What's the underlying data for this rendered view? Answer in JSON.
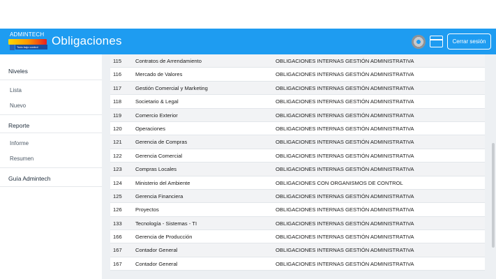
{
  "app": {
    "logo_text": "ADMINTECH",
    "logo_subtext": "Todo bajo control",
    "page_title": "Obligaciones",
    "logout_label": "Cerrar sesión",
    "icons": [
      "gear-icon",
      "window-icon"
    ],
    "accent_color": "#1e9cf1"
  },
  "sidebar": {
    "sections": [
      {
        "label": "Niveles",
        "items": [
          "Lista",
          "Nuevo"
        ]
      },
      {
        "label": "Reporte",
        "items": [
          "Informe",
          "Resumen"
        ]
      },
      {
        "label": "Guía Admintech",
        "items": []
      }
    ]
  },
  "table": {
    "rows": [
      {
        "code": "115",
        "name": "Contratos de Arrendamiento",
        "type": "OBLIGACIONES INTERNAS GESTIÓN ADMINISTRATIVA"
      },
      {
        "code": "116",
        "name": "Mercado de Valores",
        "type": "OBLIGACIONES INTERNAS GESTIÓN ADMINISTRATIVA"
      },
      {
        "code": "117",
        "name": "Gestión Comercial y Marketing",
        "type": "OBLIGACIONES INTERNAS GESTIÓN ADMINISTRATIVA"
      },
      {
        "code": "118",
        "name": "Societario & Legal",
        "type": "OBLIGACIONES INTERNAS GESTIÓN ADMINISTRATIVA"
      },
      {
        "code": "119",
        "name": "Comercio Exterior",
        "type": "OBLIGACIONES INTERNAS GESTIÓN ADMINISTRATIVA"
      },
      {
        "code": "120",
        "name": "Operaciones",
        "type": "OBLIGACIONES INTERNAS GESTIÓN ADMINISTRATIVA"
      },
      {
        "code": "121",
        "name": "Gerencia de Compras",
        "type": "OBLIGACIONES INTERNAS GESTIÓN ADMINISTRATIVA"
      },
      {
        "code": "122",
        "name": "Gerencia Comercial",
        "type": "OBLIGACIONES INTERNAS GESTIÓN ADMINISTRATIVA"
      },
      {
        "code": "123",
        "name": "Compras Locales",
        "type": "OBLIGACIONES INTERNAS GESTIÓN ADMINISTRATIVA"
      },
      {
        "code": "124",
        "name": "Ministerio del Ambiente",
        "type": "OBLIGACIONES CON ORGANISMOS DE CONTROL"
      },
      {
        "code": "125",
        "name": "Gerencia Financiera",
        "type": "OBLIGACIONES INTERNAS GESTIÓN ADMINISTRATIVA"
      },
      {
        "code": "126",
        "name": "Proyectos",
        "type": "OBLIGACIONES INTERNAS GESTIÓN ADMINISTRATIVA"
      },
      {
        "code": "133",
        "name": "Tecnología - Sistemas - TI",
        "type": "OBLIGACIONES INTERNAS GESTIÓN ADMINISTRATIVA"
      },
      {
        "code": "166",
        "name": "Gerencia de Producción",
        "type": "OBLIGACIONES INTERNAS GESTIÓN ADMINISTRATIVA"
      },
      {
        "code": "167",
        "name": "Contador General",
        "type": "OBLIGACIONES INTERNAS GESTIÓN ADMINISTRATIVA"
      },
      {
        "code": "167",
        "name": "Contador General",
        "type": "OBLIGACIONES INTERNAS GESTIÓN ADMINISTRATIVA"
      }
    ]
  }
}
